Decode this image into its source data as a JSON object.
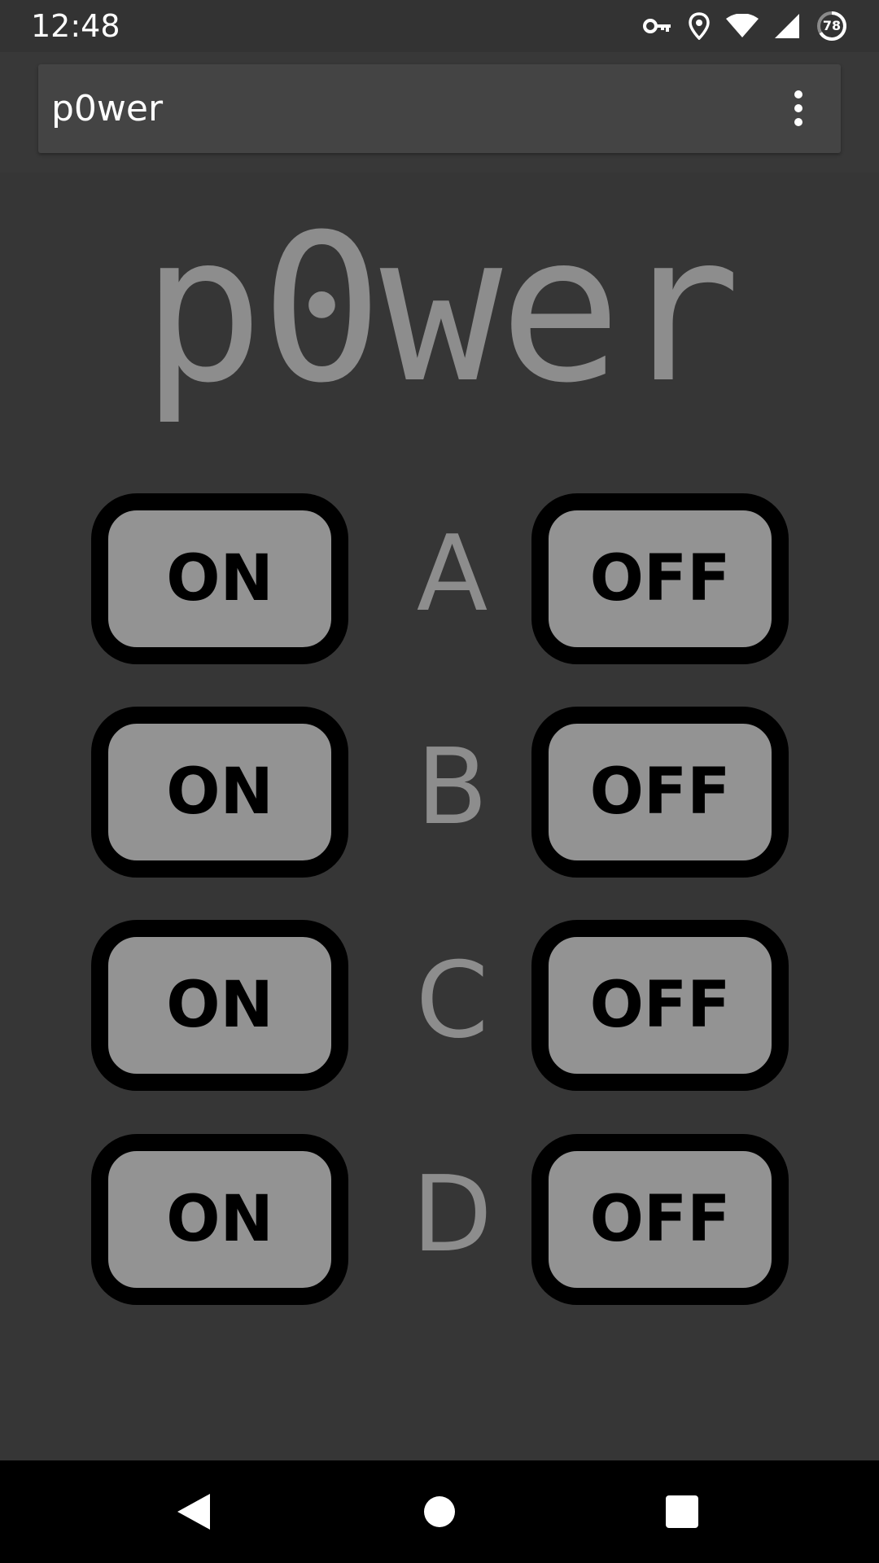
{
  "status_bar": {
    "time": "12:48",
    "icons": [
      "vpn-key-icon",
      "location-icon",
      "wifi-icon",
      "cell-signal-icon",
      "battery-icon"
    ],
    "battery_level": "78"
  },
  "toolbar": {
    "title": "p0wer",
    "menu_icon": "overflow-menu-icon"
  },
  "logo": {
    "text": "p0wer"
  },
  "outlets": [
    {
      "label": "A",
      "on_label": "ON",
      "off_label": "OFF"
    },
    {
      "label": "B",
      "on_label": "ON",
      "off_label": "OFF"
    },
    {
      "label": "C",
      "on_label": "ON",
      "off_label": "OFF"
    },
    {
      "label": "D",
      "on_label": "ON",
      "off_label": "OFF"
    }
  ],
  "nav_bar": {
    "icons": [
      "back-icon",
      "home-icon",
      "recents-icon"
    ]
  },
  "colors": {
    "background": "#363636",
    "button_fill": "#939393",
    "button_border": "#000000",
    "label_text": "#8d8d8d"
  }
}
